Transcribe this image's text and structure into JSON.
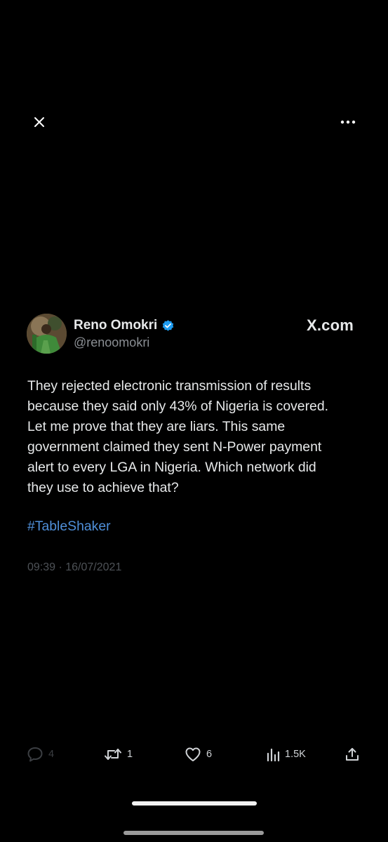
{
  "topbar": {
    "close_icon": "close-icon",
    "more_icon": "more-horizontal-icon"
  },
  "tweet": {
    "author_name": "Reno Omokri",
    "verified_icon": "verified-badge-icon",
    "verified_color": "#1d9bf0",
    "author_handle": "@renoomokri",
    "site": "X.com",
    "text_lines": [
      "They rejected electronic transmission of results",
      "because they said only 43% of Nigeria is covered.",
      "Let me prove that they are liars. This same",
      "government claimed they sent N-Power payment",
      "alert to every LGA in Nigeria. Which network did",
      "they use to achieve that?"
    ],
    "hashtag": "#TableShaker",
    "hashtag_color": "#4f8fd9",
    "timestamp": "09:39 · 16/07/2021"
  },
  "actions": {
    "reply": {
      "icon": "reply-icon",
      "count": "4"
    },
    "retweet": {
      "icon": "retweet-icon",
      "count": "1"
    },
    "like": {
      "icon": "heart-icon",
      "count": "6"
    },
    "views": {
      "icon": "views-chart-icon",
      "count": "1.5K"
    },
    "share": {
      "icon": "share-icon"
    }
  }
}
